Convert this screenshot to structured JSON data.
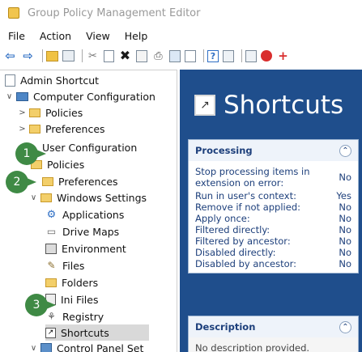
{
  "window": {
    "title": "Group Policy Management Editor"
  },
  "menu": {
    "items": [
      "File",
      "Action",
      "View",
      "Help"
    ]
  },
  "tree": {
    "items": [
      {
        "label": "Admin Shortcut"
      },
      {
        "label": "Computer Configuration"
      },
      {
        "label": "Policies"
      },
      {
        "label": "Preferences"
      },
      {
        "label": "User Configuration"
      },
      {
        "label": "Policies"
      },
      {
        "label": "Preferences"
      },
      {
        "label": "Windows Settings"
      },
      {
        "label": "Applications"
      },
      {
        "label": "Drive Maps"
      },
      {
        "label": "Environment"
      },
      {
        "label": "Files"
      },
      {
        "label": "Folders"
      },
      {
        "label": "Ini Files"
      },
      {
        "label": "Registry"
      },
      {
        "label": "Shortcuts"
      },
      {
        "label": "Control Panel Set"
      }
    ]
  },
  "callouts": [
    "1",
    "2",
    "3"
  ],
  "right": {
    "heading": "Shortcuts",
    "processing": {
      "title": "Processing",
      "rows": [
        {
          "key": "Stop processing items in extension on error:",
          "value": "No"
        },
        {
          "key": "Run in user's context:",
          "value": "Yes"
        },
        {
          "key": "Remove if not applied:",
          "value": "No"
        },
        {
          "key": "Apply once:",
          "value": "No"
        },
        {
          "key": "Filtered directly:",
          "value": "No"
        },
        {
          "key": "Filtered by ancestor:",
          "value": "No"
        },
        {
          "key": "Disabled directly:",
          "value": "No"
        },
        {
          "key": "Disabled by ancestor:",
          "value": "No"
        }
      ]
    },
    "description": {
      "title": "Description",
      "text": "No description provided."
    }
  }
}
